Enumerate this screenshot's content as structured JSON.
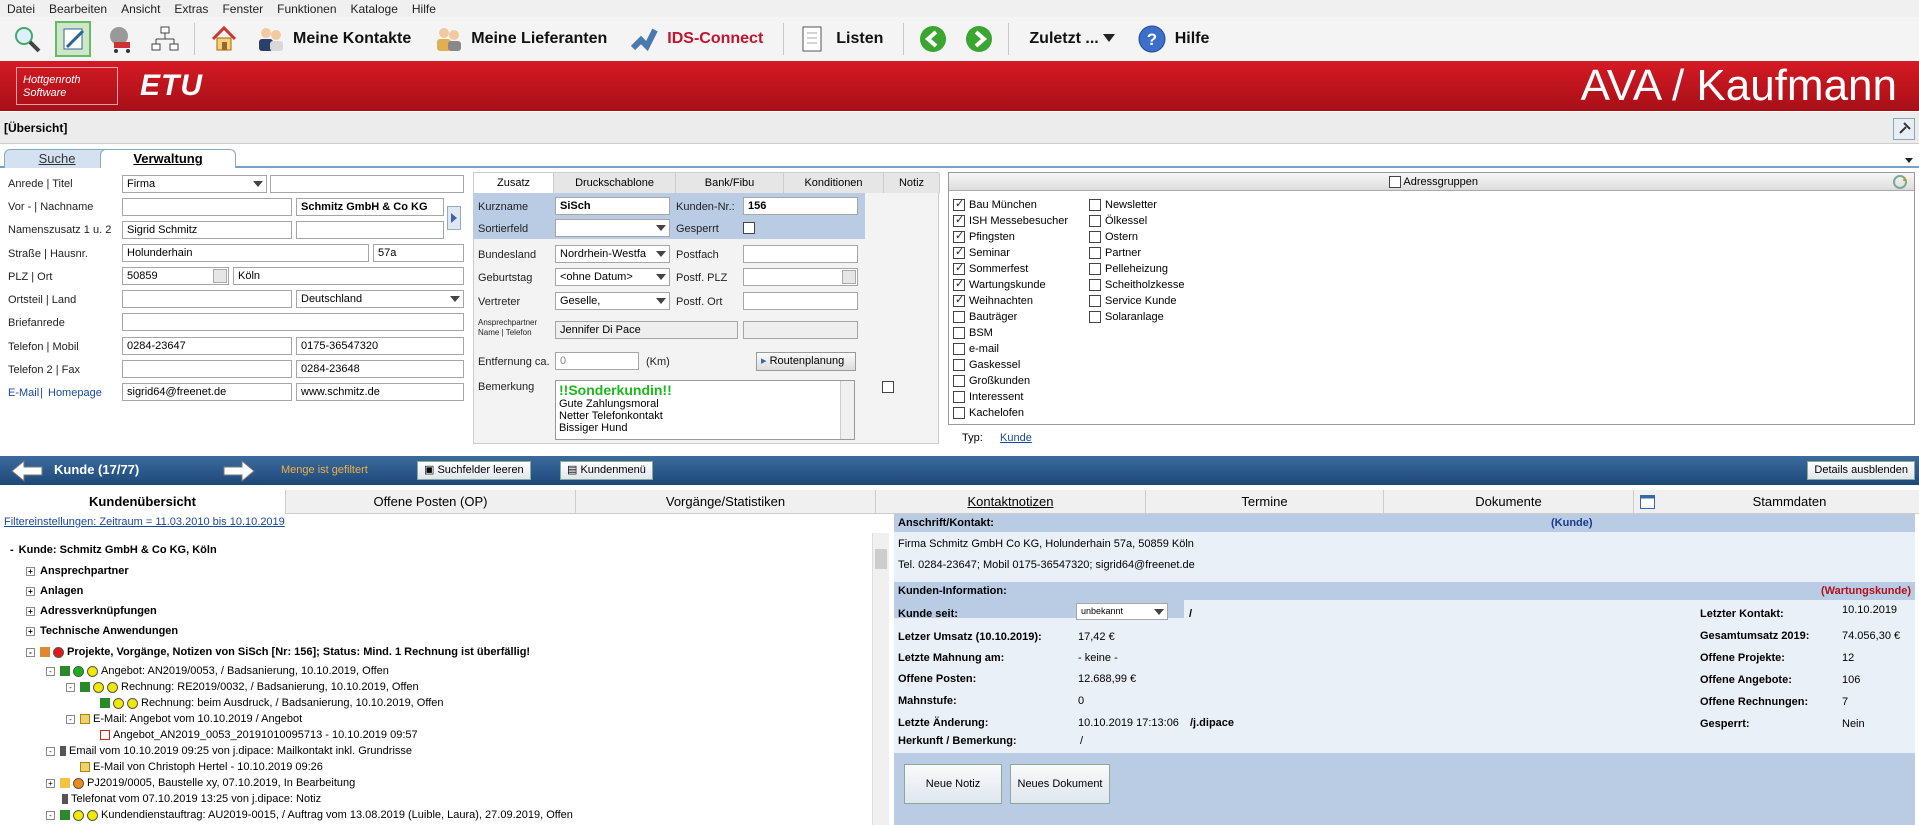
{
  "menu": [
    "Datei",
    "Bearbeiten",
    "Ansicht",
    "Extras",
    "Fenster",
    "Funktionen",
    "Kataloge",
    "Hilfe"
  ],
  "toolbar": {
    "kontakte": "Meine Kontakte",
    "lieferanten": "Meine Lieferanten",
    "ids": "IDS-Connect",
    "listen": "Listen",
    "zuletzt": "Zuletzt ...",
    "hilfe": "Hilfe"
  },
  "banner": {
    "brand_line1": "Hottgenroth",
    "brand_line2": "Software",
    "etu": "ETU",
    "title": "AVA / Kaufmann"
  },
  "overview": "[Übersicht]",
  "tabs": {
    "suche": "Suche",
    "verwaltung": "Verwaltung"
  },
  "form": {
    "l_anrede": "Anrede | Titel",
    "anrede": "Firma",
    "l_name": "Vor - | Nachname",
    "nachname": "Schmitz GmbH & Co KG",
    "l_namenszusatz": "Namenszusatz 1 u. 2",
    "namenszusatz1": "Sigrid Schmitz",
    "l_strasse": "Straße | Hausnr.",
    "strasse": "Holunderhain",
    "hausnr": "57a",
    "l_plz": "PLZ | Ort",
    "plz": "50859",
    "ort": "Köln",
    "l_ortsteil": "Ortsteil | Land",
    "land": "Deutschland",
    "l_briefanrede": "Briefanrede",
    "l_telefon": "Telefon | Mobil",
    "telefon": "0284-23647",
    "mobil": "0175-36547320",
    "l_telefon2": "Telefon 2 | Fax",
    "fax": "0284-23648",
    "l_email": "E-Mail",
    "l_homepage": "Homepage",
    "email": "sigrid64@freenet.de",
    "homepage": "www.schmitz.de"
  },
  "zusatz": {
    "tabs": [
      "Zusatz",
      "Druckschablone",
      "Bank/Fibu",
      "Konditionen",
      "Notiz"
    ],
    "l_kurzname": "Kurzname",
    "kurzname": "SiSch",
    "l_kundennr": "Kunden-Nr.:",
    "kundennr": "156",
    "l_sortierfeld": "Sortierfeld",
    "l_gesperrt": "Gesperrt",
    "l_bundesland": "Bundesland",
    "bundesland": "Nordrhein-Westfa",
    "l_postfach": "Postfach",
    "l_geburtstag": "Geburtstag",
    "geburtstag": "<ohne Datum>",
    "l_postfplz": "Postf. PLZ",
    "l_vertreter": "Vertreter",
    "vertreter": "Geselle,",
    "l_postfort": "Postf. Ort",
    "l_ansprech1": "Ansprechpartner",
    "l_ansprech2": "Name | Telefon",
    "ansprech": "Jennifer Di Pace",
    "l_entfernung": "Entfernung ca.",
    "entfernung": "0",
    "km": "(Km)",
    "routen": "Routenplanung",
    "l_bemerkung": "Bemerkung",
    "bem1": "!!Sonderkundin!!",
    "bem2": "Gute Zahlungsmoral",
    "bem3": "Netter Telefonkontakt",
    "bem4": "Bissiger Hund"
  },
  "adressgruppen": {
    "title": "Adressgruppen",
    "col1": [
      {
        "label": "Bau München",
        "on": true
      },
      {
        "label": "ISH Messebesucher",
        "on": true
      },
      {
        "label": "Pfingsten",
        "on": true
      },
      {
        "label": "Seminar",
        "on": true
      },
      {
        "label": "Sommerfest",
        "on": true
      },
      {
        "label": "Wartungskunde",
        "on": true
      },
      {
        "label": "Weihnachten",
        "on": true
      },
      {
        "label": "Bauträger",
        "on": false
      },
      {
        "label": "BSM",
        "on": false
      },
      {
        "label": "e-mail",
        "on": false
      },
      {
        "label": "Gaskessel",
        "on": false
      },
      {
        "label": "Großkunden",
        "on": false
      },
      {
        "label": "Interessent",
        "on": false
      },
      {
        "label": "Kachelofen",
        "on": false
      }
    ],
    "col2": [
      {
        "label": "Newsletter",
        "on": false
      },
      {
        "label": "Ölkessel",
        "on": false
      },
      {
        "label": "Ostern",
        "on": false
      },
      {
        "label": "Partner",
        "on": false
      },
      {
        "label": "Pelleheizung",
        "on": false
      },
      {
        "label": "Scheitholzkesse",
        "on": false
      },
      {
        "label": "Service Kunde",
        "on": false
      },
      {
        "label": "Solaranlage",
        "on": false
      }
    ],
    "l_typ": "Typ:",
    "typ": "Kunde"
  },
  "nav": {
    "kunde": "Kunde (17/77)",
    "gefiltert": "Menge ist gefiltert",
    "suchfelder": "Suchfelder leeren",
    "kundenmenu": "Kundenmenü",
    "details": "Details ausblenden"
  },
  "subtabs": [
    "Kundenübersicht",
    "Offene Posten (OP)",
    "Vorgänge/Statistiken",
    "Kontaktnotizen",
    "Termine",
    "Dokumente",
    "Stammdaten"
  ],
  "filter": "Filtereinstellungen: Zeitraum = 11.03.2010 bis 10.10.2019",
  "tree": {
    "root": "Kunde:  Schmitz GmbH & Co KG, Köln",
    "ansprech": "Ansprechpartner",
    "anlagen": "Anlagen",
    "adressverk": "Adressverknüpfungen",
    "techn": "Technische Anwendungen",
    "projekte": "Projekte, Vorgänge, Notizen von SiSch [Nr: 156]; Status: Mind. 1 Rechnung ist überfällig!",
    "r1": "Angebot: AN2019/0053,  / Badsanierung, 10.10.2019, Offen",
    "r2": "Rechnung: RE2019/0032,  / Badsanierung, 10.10.2019, Offen",
    "r3": "Rechnung: beim Ausdruck,  / Badsanierung, 10.10.2019, Offen",
    "r4": "E-Mail: Angebot vom 10.10.2019 / Angebot",
    "r5": "Angebot_AN2019_0053_20191010095713 - 10.10.2019 09:57",
    "r6": "Email vom 10.10.2019 09:25  von j.dipace: Mailkontakt inkl. Grundrisse",
    "r7": "E-Mail von Christoph Hertel - 10.10.2019 09:26",
    "r8": "PJ2019/0005, Baustelle xy, 07.10.2019, In Bearbeitung",
    "r9": "Telefonat vom 07.10.2019 13:25  von j.dipace: Notiz",
    "r10": "Kundendienstauftrag: AU2019-0015,  / Auftrag vom 13.08.2019 (Luible, Laura), 27.09.2019, Offen"
  },
  "detail": {
    "h_anschrift": "Anschrift/Kontakt:",
    "h_kunde": "(Kunde)",
    "anschrift": "Firma  Schmitz GmbH  Co KG, Holunderhain 57a, 50859 Köln",
    "kontakt": "Tel. 0284-23647; Mobil 0175-36547320; sigrid64@freenet.de",
    "h_info": "Kunden-Information:",
    "h_wartung": "(Wartungskunde)",
    "l_kundeseit": "Kunde seit:",
    "kundeseit": "unbekannt",
    "slash": "/",
    "l_umsatz": "Letzer Umsatz (10.10.2019):",
    "umsatz": "17,42 €",
    "l_mahnung": "Letzte Mahnung am:",
    "mahnung": "- keine -",
    "l_posten": "Offene Posten:",
    "posten": "12.688,99 €",
    "l_mahnstufe": "Mahnstufe:",
    "mahnstufe": "0",
    "l_aenderung": "Letzte Änderung:",
    "aenderung": "10.10.2019 17:13:06",
    "aenderung_user": "/j.dipace",
    "l_herkunft": "Herkunft / Bemerkung:",
    "herkunft": "/",
    "l_kontakt": "Letzter Kontakt:",
    "letzterkontakt": "10.10.2019",
    "l_gesamt": "Gesamtumsatz 2019:",
    "gesamt": "74.056,30 €",
    "l_projekte": "Offene Projekte:",
    "projekte": "12",
    "l_angebote": "Offene Angebote:",
    "angebote": "106",
    "l_rechnungen": "Offene Rechnungen:",
    "rechnungen": "7",
    "l_gesperrt": "Gesperrt:",
    "gesperrt": "Nein",
    "neuenotiz": "Neue Notiz",
    "neuesdok": "Neues Dokument"
  }
}
